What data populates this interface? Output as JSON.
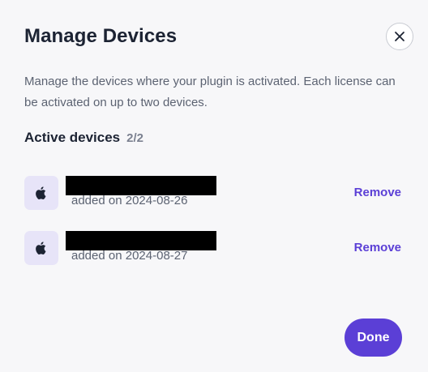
{
  "dialog": {
    "title": "Manage Devices",
    "description": "Manage the devices where your plugin is activated. Each license can be activated on up to two devices.",
    "close_icon": "close-icon",
    "section_title": "Active devices",
    "section_count": "2/2",
    "devices": [
      {
        "icon": "apple-icon",
        "added": "added on 2024-08-26",
        "remove_label": "Remove"
      },
      {
        "icon": "apple-icon",
        "added": "added on 2024-08-27",
        "remove_label": "Remove"
      }
    ],
    "done_label": "Done"
  },
  "colors": {
    "accent": "#5b3fd6",
    "background": "#f7f7f9",
    "icon_tile": "#e7e4f8",
    "text_primary": "#1c2333",
    "text_secondary": "#5c6372"
  }
}
